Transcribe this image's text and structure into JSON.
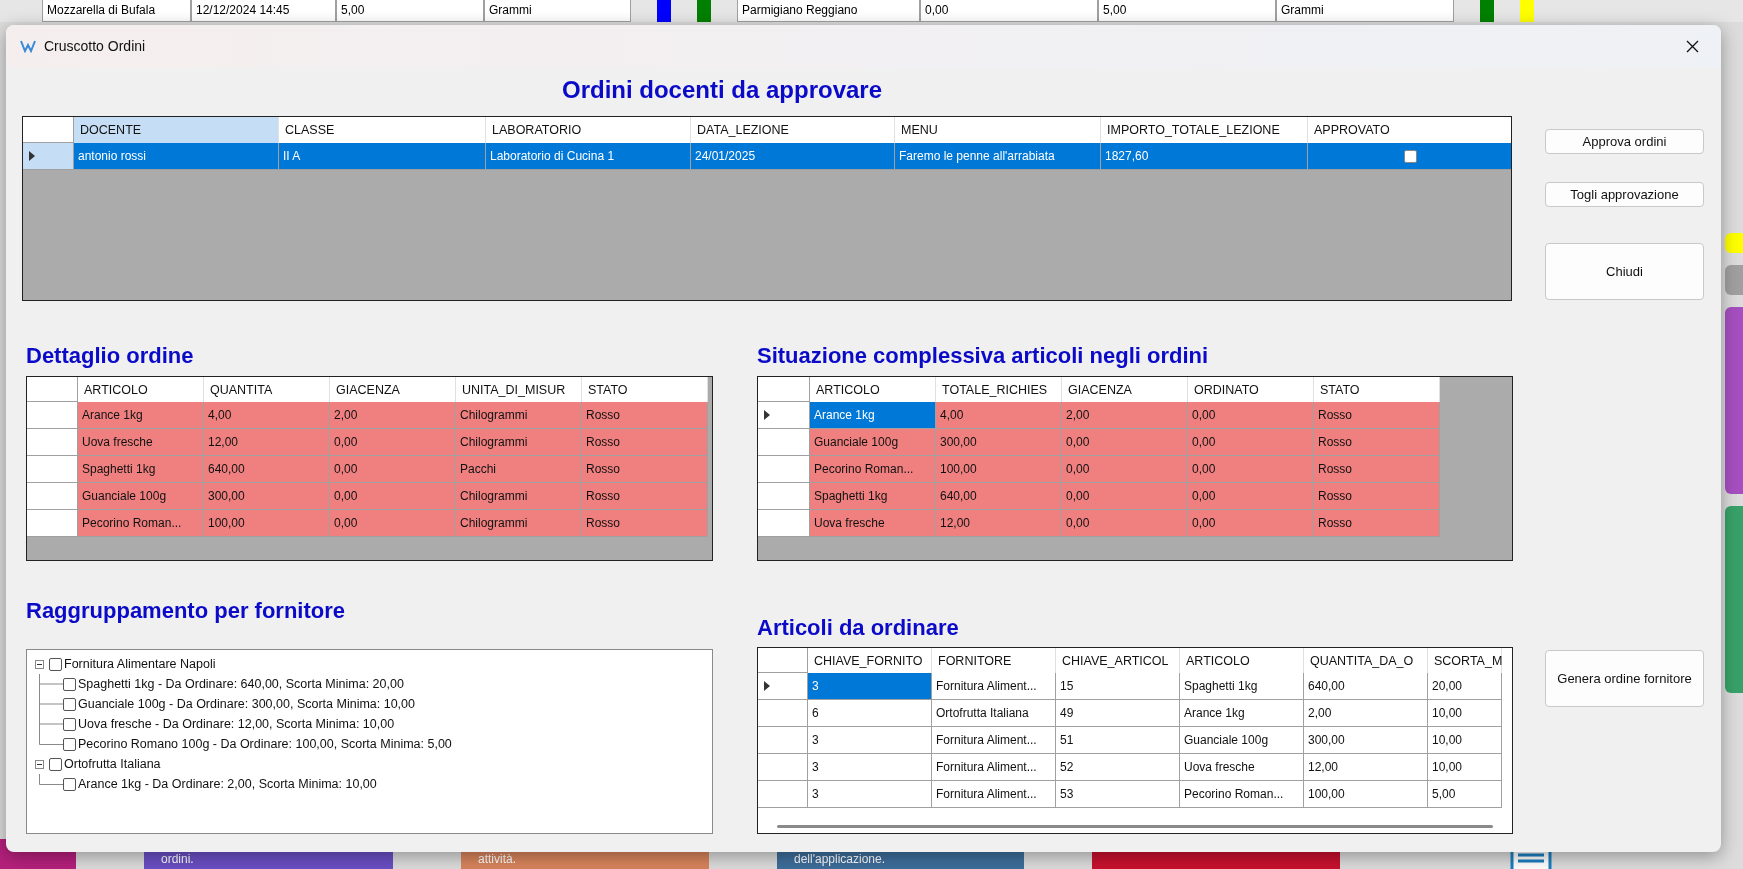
{
  "background": {
    "top_rows": [
      {
        "cells": [
          "Mozzarella di Bufala",
          "12/12/2024 14:45",
          "5,00",
          "Grammi"
        ],
        "bars": [
          {
            "color": "#0000ff"
          },
          {
            "color": "#008000"
          }
        ]
      },
      {
        "cells": [
          "Parmigiano Reggiano",
          "0,00",
          "5,00",
          "Grammi"
        ],
        "bars": [
          {
            "color": "#008000"
          },
          {
            "color": "#ffff00"
          }
        ]
      }
    ],
    "side_tiles": [
      {
        "color": "#ffff00"
      },
      {
        "color": "#a0a0a0"
      },
      {
        "color": "#a64fc0"
      },
      {
        "color": "#38a169"
      }
    ],
    "tiles": [
      {
        "color": "#b5207c"
      },
      {
        "text": "ordini.",
        "color": "#6a4fc4"
      },
      {
        "text": "attività.",
        "color": "#d8845c"
      },
      {
        "text": "dell'applicazione.",
        "color": "#3e6e9b"
      },
      {
        "color": "#c8102e"
      }
    ]
  },
  "window": {
    "title": "Cruscotto Ordini"
  },
  "approval": {
    "title": "Ordini docenti da approvare",
    "columns": [
      {
        "label": "DOCENTE",
        "selected": true
      },
      {
        "label": "CLASSE",
        "selected": false
      },
      {
        "label": "LABORATORIO",
        "selected": false
      },
      {
        "label": "DATA_LEZIONE",
        "selected": false
      },
      {
        "label": "MENU",
        "selected": false
      },
      {
        "label": "IMPORTO_TOTALE_LEZIONE",
        "selected": false
      },
      {
        "label": "APPROVATO",
        "selected": false
      }
    ],
    "rows": [
      {
        "cells": [
          "antonio rossi",
          "II A",
          "Laboratorio di Cucina 1",
          "24/01/2025",
          "Faremo le penne all'arrabiata",
          "1827,60"
        ],
        "approved": false,
        "selected": true
      }
    ]
  },
  "actions": [
    {
      "label": "Approva ordini",
      "kind": "small"
    },
    {
      "label": "Togli approvazione",
      "kind": "small"
    },
    {
      "label": "Chiudi",
      "kind": "large"
    }
  ],
  "detail": {
    "title": "Dettaglio ordine",
    "columns": [
      "ARTICOLO",
      "QUANTITA",
      "GIACENZA",
      "UNITA_DI_MISUR",
      "STATO"
    ],
    "rows": [
      {
        "cells": [
          "Arance 1kg",
          "4,00",
          "2,00",
          "Chilogrammi",
          "Rosso"
        ],
        "selected": false,
        "highlighted": true
      },
      {
        "cells": [
          "Uova fresche",
          "12,00",
          "0,00",
          "Chilogrammi",
          "Rosso"
        ],
        "selected": false,
        "highlighted": true
      },
      {
        "cells": [
          "Spaghetti 1kg",
          "640,00",
          "0,00",
          "Pacchi",
          "Rosso"
        ],
        "selected": false,
        "highlighted": true
      },
      {
        "cells": [
          "Guanciale 100g",
          "300,00",
          "0,00",
          "Chilogrammi",
          "Rosso"
        ],
        "selected": false,
        "highlighted": true
      },
      {
        "cells": [
          "Pecorino Roman...",
          "100,00",
          "0,00",
          "Chilogrammi",
          "Rosso"
        ],
        "selected": false,
        "highlighted": true
      }
    ]
  },
  "summary": {
    "title": "Situazione complessiva articoli negli ordini",
    "columns": [
      "ARTICOLO",
      "TOTALE_RICHIES",
      "GIACENZA",
      "ORDINATO",
      "STATO"
    ],
    "rows": [
      {
        "cells": [
          "Arance 1kg",
          "4,00",
          "2,00",
          "0,00",
          "Rosso"
        ],
        "selected": true,
        "highlighted": true
      },
      {
        "cells": [
          "Guanciale 100g",
          "300,00",
          "0,00",
          "0,00",
          "Rosso"
        ],
        "selected": false,
        "highlighted": true
      },
      {
        "cells": [
          "Pecorino Roman...",
          "100,00",
          "0,00",
          "0,00",
          "Rosso"
        ],
        "selected": false,
        "highlighted": true
      },
      {
        "cells": [
          "Spaghetti 1kg",
          "640,00",
          "0,00",
          "0,00",
          "Rosso"
        ],
        "selected": false,
        "highlighted": true
      },
      {
        "cells": [
          "Uova fresche",
          "12,00",
          "0,00",
          "0,00",
          "Rosso"
        ],
        "selected": false,
        "highlighted": true
      }
    ]
  },
  "grouping": {
    "title": "Raggruppamento per fornitore",
    "tree": [
      {
        "label": "Fornitura Alimentare Napoli",
        "checked": false,
        "expanded": true,
        "children": [
          {
            "label": "Spaghetti 1kg - Da Ordinare: 640,00, Scorta Minima: 20,00",
            "checked": false
          },
          {
            "label": "Guanciale 100g - Da Ordinare: 300,00, Scorta Minima: 10,00",
            "checked": false
          },
          {
            "label": "Uova fresche - Da Ordinare: 12,00, Scorta Minima: 10,00",
            "checked": false
          },
          {
            "label": "Pecorino Romano 100g - Da Ordinare: 100,00, Scorta Minima: 5,00",
            "checked": false
          }
        ]
      },
      {
        "label": "Ortofrutta Italiana",
        "checked": false,
        "expanded": true,
        "children": [
          {
            "label": "Arance 1kg - Da Ordinare: 2,00, Scorta Minima: 10,00",
            "checked": false
          }
        ]
      }
    ]
  },
  "to_order": {
    "title": "Articoli da ordinare",
    "columns": [
      "CHIAVE_FORNITO",
      "FORNITORE",
      "CHIAVE_ARTICOL",
      "ARTICOLO",
      "QUANTITA_DA_O",
      "SCORTA_M"
    ],
    "rows": [
      {
        "cells": [
          "3",
          "Fornitura Aliment...",
          "15",
          "Spaghetti 1kg",
          "640,00",
          "20,00"
        ],
        "selected": true,
        "highlighted": false
      },
      {
        "cells": [
          "6",
          "Ortofrutta Italiana",
          "49",
          "Arance 1kg",
          "2,00",
          "10,00"
        ],
        "selected": false,
        "highlighted": false
      },
      {
        "cells": [
          "3",
          "Fornitura Aliment...",
          "51",
          "Guanciale 100g",
          "300,00",
          "10,00"
        ],
        "selected": false,
        "highlighted": false
      },
      {
        "cells": [
          "3",
          "Fornitura Aliment...",
          "52",
          "Uova fresche",
          "12,00",
          "10,00"
        ],
        "selected": false,
        "highlighted": false
      },
      {
        "cells": [
          "3",
          "Fornitura Aliment...",
          "53",
          "Pecorino Roman...",
          "100,00",
          "5,00"
        ],
        "selected": false,
        "highlighted": false
      }
    ]
  },
  "generate_button": {
    "label": "Genera ordine fornitore"
  }
}
